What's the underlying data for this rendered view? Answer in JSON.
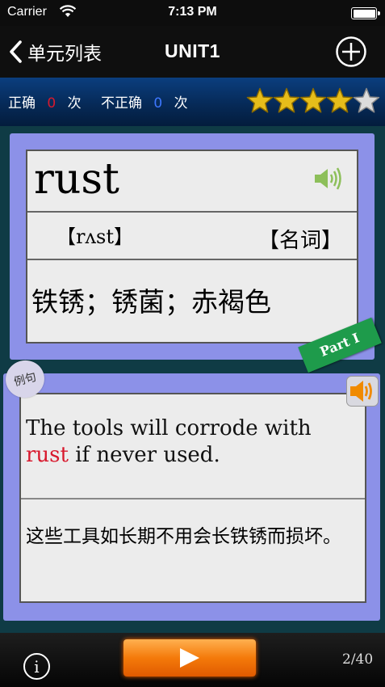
{
  "status_bar": {
    "carrier": "Carrier",
    "time": "7:13 PM"
  },
  "nav": {
    "back_label": "单元列表",
    "title": "UNIT1"
  },
  "stats": {
    "correct_label": "正确",
    "correct_count": "0",
    "correct_unit": "次",
    "incorrect_label": "不正确",
    "incorrect_count": "0",
    "incorrect_unit": "次",
    "rating": {
      "filled": 4,
      "total": 5
    }
  },
  "word_card": {
    "word": "rust",
    "phonetic": "【rʌst】",
    "part_of_speech": "【名词】",
    "meaning": "铁锈；锈菌；赤褐色",
    "part_tag": "Part I"
  },
  "example": {
    "badge": "例句",
    "en_before": "The tools will corrode with ",
    "en_highlight": "rust",
    "en_after": " if never used.",
    "cn": "这些工具如长期不用会长铁锈而损坏。"
  },
  "footer": {
    "info_icon": "i",
    "page": "2/40"
  },
  "colors": {
    "accent_red": "#d8192d",
    "accent_blue": "#3d77ff",
    "card_purple": "#8c91e8",
    "play_orange": "#f47a0a",
    "tag_green": "#1e9b4b"
  },
  "icons": [
    "wifi-icon",
    "battery-icon",
    "chevron-left-icon",
    "plus-circle-icon",
    "star-icon",
    "speaker-icon",
    "info-icon",
    "play-icon"
  ]
}
